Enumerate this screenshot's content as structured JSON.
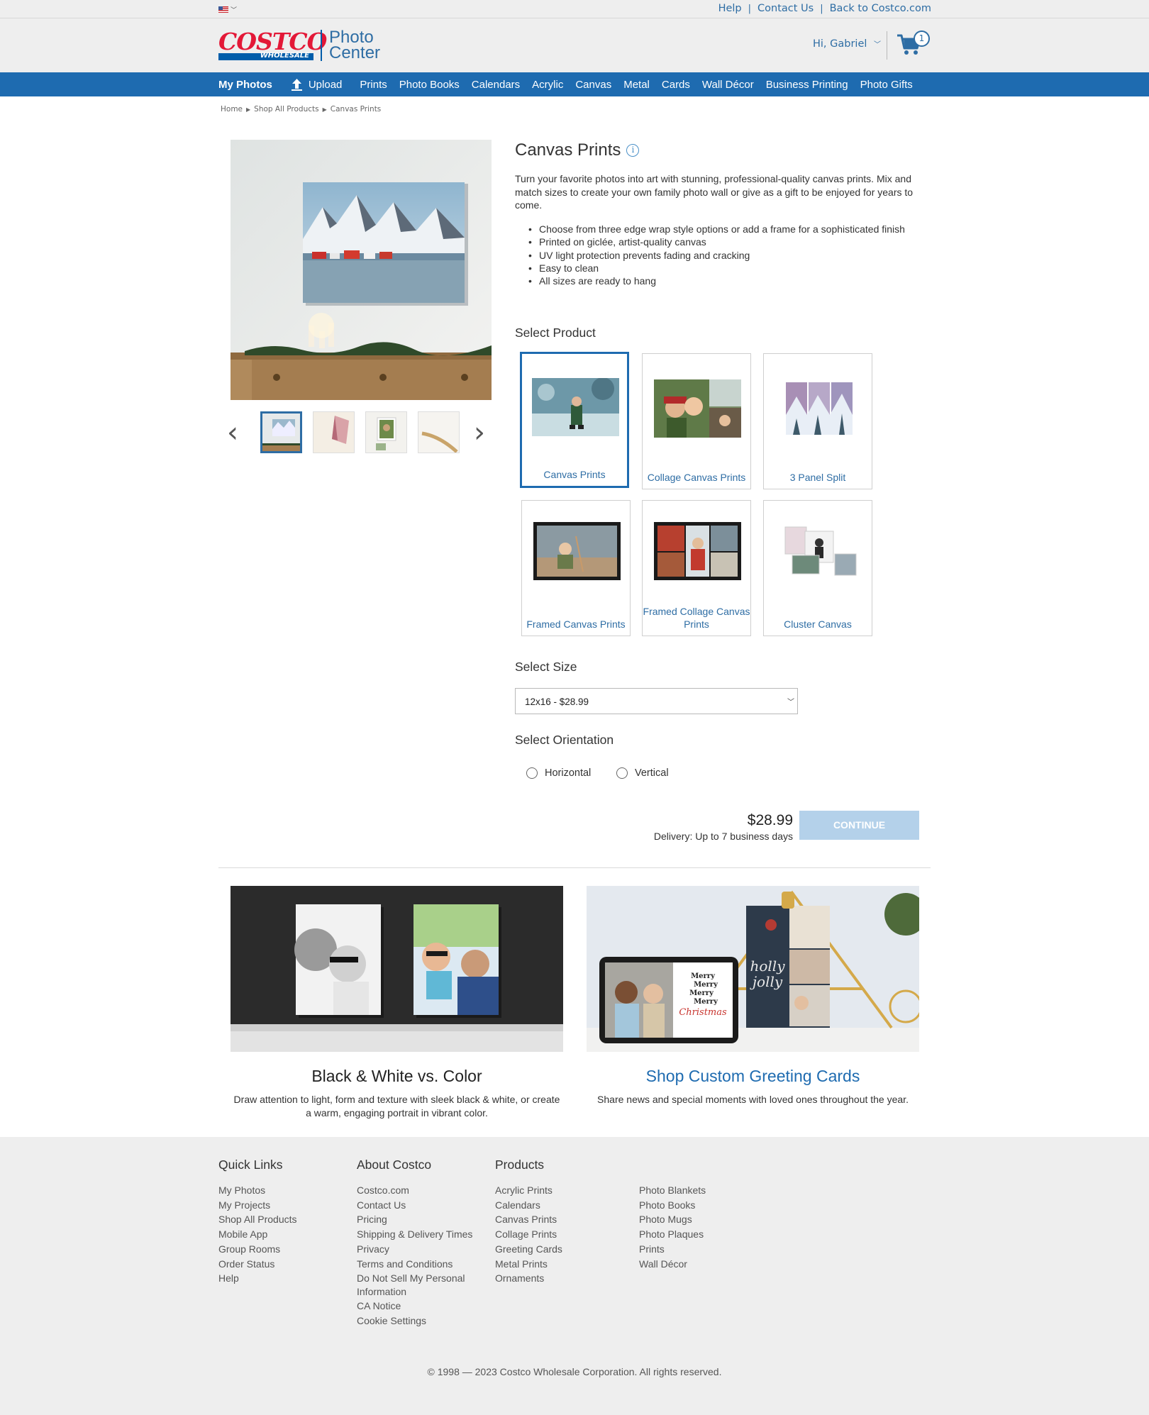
{
  "util": {
    "help": "Help",
    "contact": "Contact Us",
    "back": "Back to Costco.com"
  },
  "header": {
    "logo_main": "COSTCO",
    "logo_sub": "WHOLESALE",
    "photo_center_line1": "Photo",
    "photo_center_line2": "Center",
    "greeting": "Hi, Gabriel",
    "cart_count": "1"
  },
  "nav": {
    "my_photos": "My Photos",
    "upload": "Upload",
    "items": [
      "Prints",
      "Photo Books",
      "Calendars",
      "Acrylic",
      "Canvas",
      "Metal",
      "Cards",
      "Wall Décor",
      "Business Printing",
      "Photo Gifts"
    ]
  },
  "breadcrumb": [
    "Home",
    "Shop All Products",
    "Canvas Prints"
  ],
  "product": {
    "title": "Canvas Prints",
    "description": "Turn your favorite photos into art with stunning, professional-quality canvas prints. Mix and match sizes to create your own family photo wall or give as a gift to be enjoyed for years to come.",
    "bullets": [
      "Choose from three edge wrap style options or add a frame for a sophisticated finish",
      "Printed on giclée, artist-quality canvas",
      "UV light protection prevents fading and cracking",
      "Easy to clean",
      "All sizes are ready to hang"
    ],
    "select_product_heading": "Select Product",
    "options": [
      {
        "label": "Canvas Prints",
        "selected": true
      },
      {
        "label": "Collage Canvas Prints",
        "selected": false
      },
      {
        "label": "3 Panel Split",
        "selected": false
      },
      {
        "label": "Framed Canvas Prints",
        "selected": false
      },
      {
        "label": "Framed Collage Canvas Prints",
        "selected": false
      },
      {
        "label": "Cluster Canvas",
        "selected": false
      }
    ],
    "select_size_heading": "Select Size",
    "size_value": "12x16 - $28.99",
    "select_orientation_heading": "Select Orientation",
    "orientations": [
      "Horizontal",
      "Vertical"
    ],
    "price": "$28.99",
    "delivery": "Delivery: Up to 7 business days",
    "continue": "CONTINUE"
  },
  "promos": [
    {
      "title": "Black & White vs. Color",
      "text": "Draw attention to light, form and texture with sleek black & white, or create a warm, engaging portrait in vibrant color."
    },
    {
      "title": "Shop Custom Greeting Cards",
      "text": "Share news and special moments with loved ones throughout the year."
    }
  ],
  "card_art": {
    "merry": [
      "Merry",
      "Merry",
      "Merry",
      "Merry"
    ],
    "christmas": "Christmas",
    "holly": "holly",
    "jolly": "jolly"
  },
  "footer": {
    "quick_links": {
      "heading": "Quick Links",
      "items": [
        "My Photos",
        "My Projects",
        "Shop All Products",
        "Mobile App",
        "Group Rooms",
        "Order Status",
        "Help"
      ]
    },
    "about": {
      "heading": "About Costco",
      "items": [
        "Costco.com",
        "Contact Us",
        "Pricing",
        "Shipping & Delivery Times",
        "Privacy",
        "Terms and Conditions",
        "Do Not Sell My Personal Information",
        "CA Notice",
        "Cookie Settings"
      ]
    },
    "products": {
      "heading": "Products",
      "items": [
        "Acrylic Prints",
        "Calendars",
        "Canvas Prints",
        "Collage Prints",
        "Greeting Cards",
        "Metal Prints",
        "Ornaments"
      ]
    },
    "products2": {
      "items": [
        "Photo Blankets",
        "Photo Books",
        "Photo Mugs",
        "Photo Plaques",
        "Prints",
        "Wall Décor"
      ]
    },
    "copyright": "© 1998 — 2023 Costco Wholesale Corporation. All rights reserved."
  },
  "colors": {
    "brand_blue": "#1e6bb0",
    "link_blue": "#2e6da4",
    "costco_red": "#e31837",
    "continue_disabled": "#b4d1ea"
  }
}
